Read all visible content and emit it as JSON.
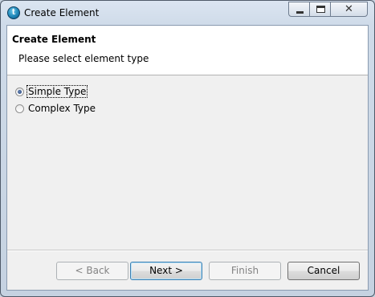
{
  "window": {
    "title": "Create Element",
    "close_glyph": "✕"
  },
  "header": {
    "title": "Create Element",
    "description": "Please select element type"
  },
  "options": [
    {
      "label": "Simple Type",
      "selected": true
    },
    {
      "label": "Complex Type",
      "selected": false
    }
  ],
  "buttons": {
    "back": "< Back",
    "next": "Next >",
    "finish": "Finish",
    "cancel": "Cancel"
  }
}
